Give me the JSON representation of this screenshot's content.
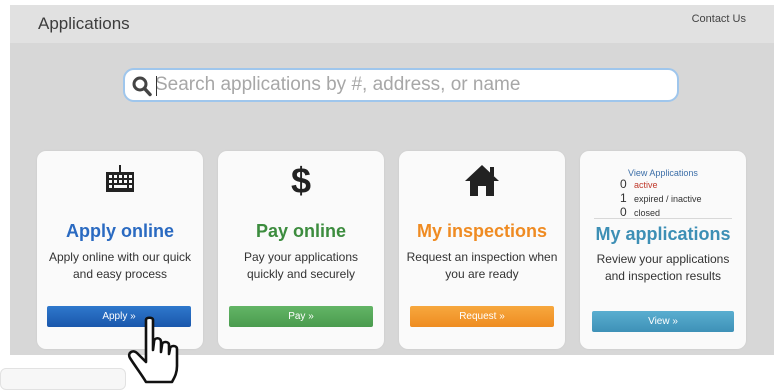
{
  "header": {
    "title": "Applications",
    "contact_link": "Contact Us"
  },
  "search": {
    "placeholder": "Search applications by #, address, or name",
    "icon": "search-icon"
  },
  "cards": [
    {
      "icon": "keyboard-icon",
      "title": "Apply online",
      "description": "Apply online with our quick and easy process",
      "button": "Apply »",
      "color": "#2a6ac1"
    },
    {
      "icon": "dollar-icon",
      "title": "Pay online",
      "description": "Pay your applications quickly and securely",
      "button": "Pay »",
      "color": "#3c8c3e"
    },
    {
      "icon": "home-icon",
      "title": "My inspections",
      "description": "Request an inspection when you are ready",
      "button": "Request »",
      "color": "#ef8b22"
    },
    {
      "title": "My applications",
      "description": "Review your applications and inspection results",
      "button": "View »",
      "color": "#3d8fb5",
      "stats": {
        "link": "View Applications",
        "active": {
          "count": "0",
          "label": "active"
        },
        "expired": {
          "count": "1",
          "label": "expired / inactive"
        },
        "closed": {
          "count": "0",
          "label": "closed"
        }
      }
    }
  ],
  "cursor": "hand-pointer-icon"
}
